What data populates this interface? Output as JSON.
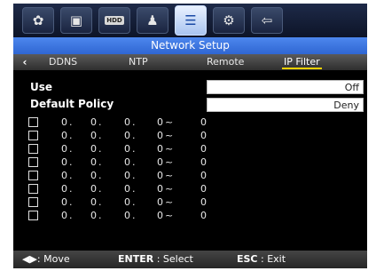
{
  "toolbar": {
    "icons": [
      {
        "name": "gear-icon",
        "glyph": "✿"
      },
      {
        "name": "monitor-icon",
        "glyph": "▣"
      },
      {
        "name": "hdd-icon",
        "glyph": "HDD"
      },
      {
        "name": "users-icon",
        "glyph": "♟"
      },
      {
        "name": "network-icon",
        "glyph": "☰"
      },
      {
        "name": "system-icon",
        "glyph": "⚙"
      },
      {
        "name": "exit-icon",
        "glyph": "⇦"
      }
    ],
    "active_index": 4
  },
  "title": "Network Setup",
  "tabs": [
    "DDNS",
    "NTP",
    "Remote",
    "IP Filter"
  ],
  "active_tab": "IP Filter",
  "settings": {
    "use_label": "Use",
    "use_value": "Off",
    "policy_label": "Default Policy",
    "policy_value": "Deny"
  },
  "filter_rows": [
    {
      "o1": "0",
      "o2": "0",
      "o3": "0",
      "start": "0",
      "end": "0"
    },
    {
      "o1": "0",
      "o2": "0",
      "o3": "0",
      "start": "0",
      "end": "0"
    },
    {
      "o1": "0",
      "o2": "0",
      "o3": "0",
      "start": "0",
      "end": "0"
    },
    {
      "o1": "0",
      "o2": "0",
      "o3": "0",
      "start": "0",
      "end": "0"
    },
    {
      "o1": "0",
      "o2": "0",
      "o3": "0",
      "start": "0",
      "end": "0"
    },
    {
      "o1": "0",
      "o2": "0",
      "o3": "0",
      "start": "0",
      "end": "0"
    },
    {
      "o1": "0",
      "o2": "0",
      "o3": "0",
      "start": "0",
      "end": "0"
    },
    {
      "o1": "0",
      "o2": "0",
      "o3": "0",
      "start": "0",
      "end": "0"
    }
  ],
  "footer": {
    "move_key": "◀▶",
    "move_label": ": Move",
    "select_key": "ENTER",
    "select_label": " : Select",
    "exit_key": "ESC",
    "exit_label": " : Exit"
  },
  "colors": {
    "title_bar": "#3a73e0",
    "tab_underline": "#f0d000",
    "background": "#000000"
  }
}
